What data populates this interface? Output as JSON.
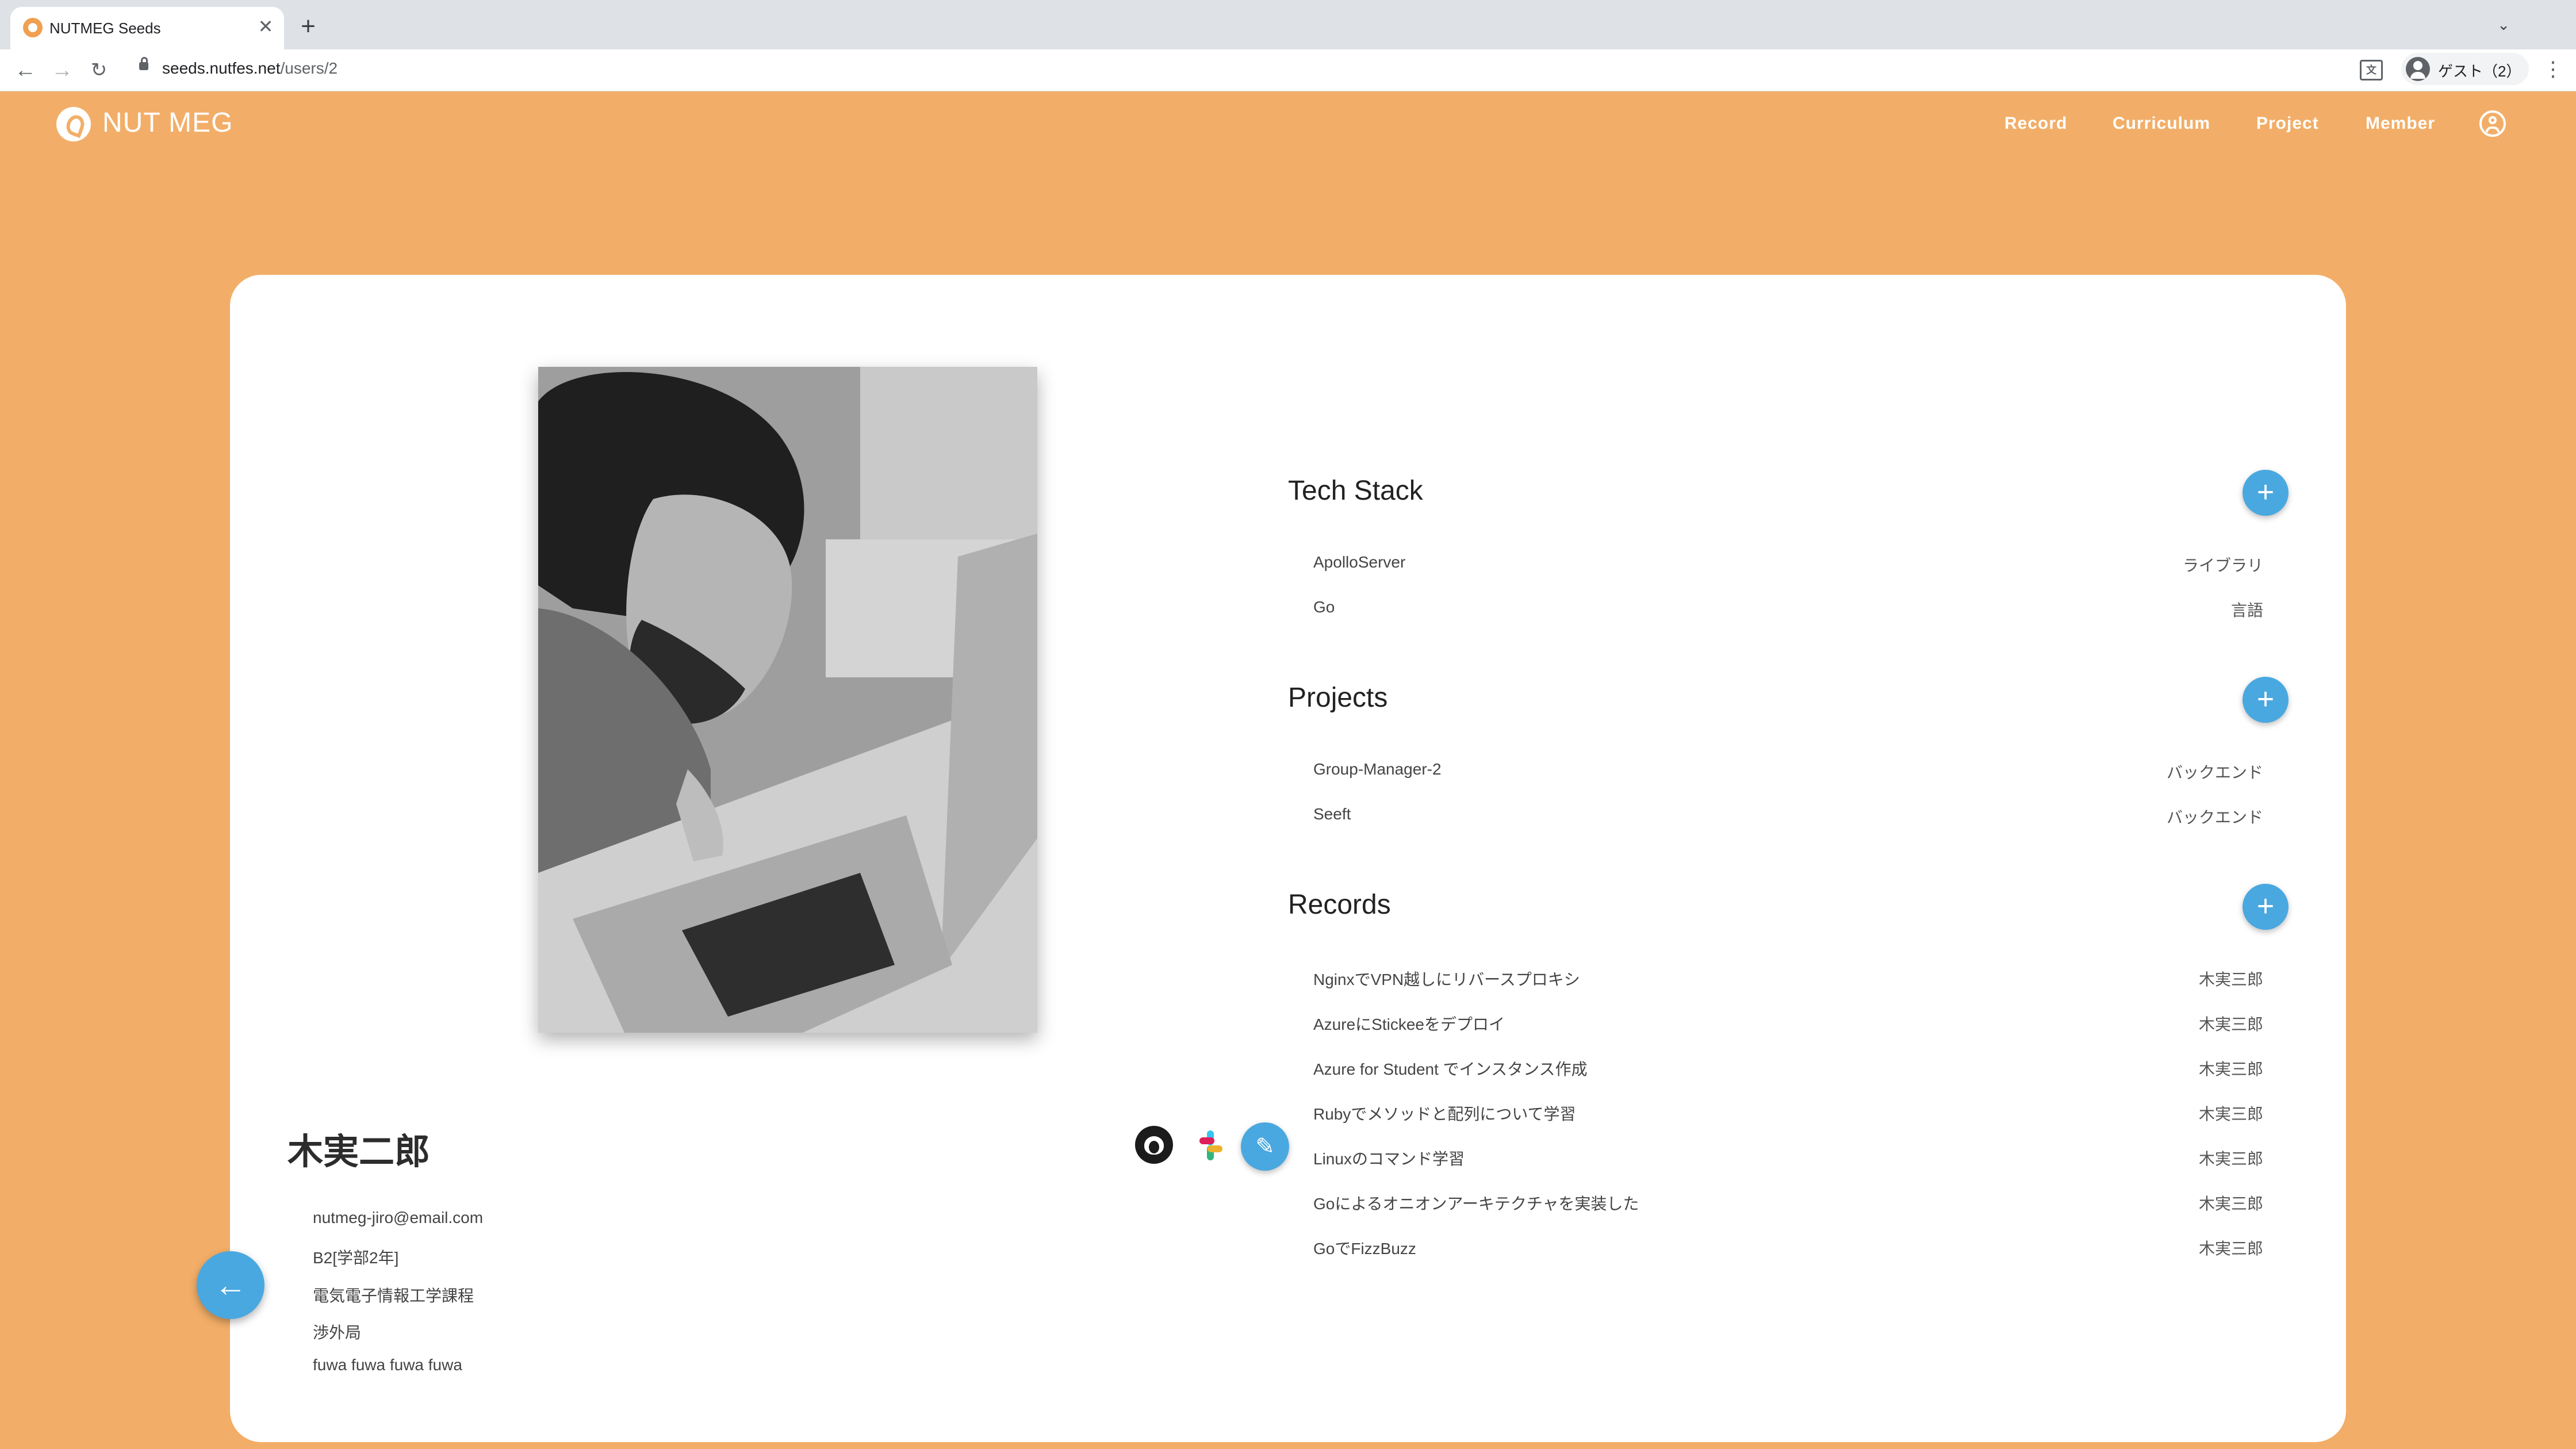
{
  "browser": {
    "tab_title": "NUTMEG Seeds",
    "tab_close": "✕",
    "new_tab": "+",
    "url_host": "seeds.nutfes.net",
    "url_path": "/users/2",
    "profile_label": "ゲスト（2）"
  },
  "navbar": {
    "logo_text": "NUT MEG",
    "links": [
      "Record",
      "Curriculum",
      "Project",
      "Member"
    ]
  },
  "user": {
    "name": "木実二郎",
    "email": "nutmeg-jiro@email.com",
    "grade": "B2[学部2年]",
    "course": "電気電子情報工学課程",
    "bureau": "渉外局",
    "bio": "fuwa fuwa fuwa fuwa"
  },
  "tech_stack": {
    "title": "Tech Stack",
    "items": [
      {
        "name": "ApolloServer",
        "category": "ライブラリ"
      },
      {
        "name": "Go",
        "category": "言語"
      }
    ]
  },
  "projects": {
    "title": "Projects",
    "items": [
      {
        "name": "Group-Manager-2",
        "role": "バックエンド"
      },
      {
        "name": "Seeft",
        "role": "バックエンド"
      }
    ]
  },
  "records": {
    "title": "Records",
    "items": [
      {
        "title": "NginxでVPN越しにリバースプロキシ",
        "author": "木実三郎"
      },
      {
        "title": "AzureにStickeeをデプロイ",
        "author": "木実三郎"
      },
      {
        "title": "Azure for Student でインスタンス作成",
        "author": "木実三郎"
      },
      {
        "title": "Rubyでメソッドと配列について学習",
        "author": "木実三郎"
      },
      {
        "title": "Linuxのコマンド学習",
        "author": "木実三郎"
      },
      {
        "title": "Goによるオニオンアーキテクチャを実装した",
        "author": "木実三郎"
      },
      {
        "title": "GoでFizzBuzz",
        "author": "木実三郎"
      }
    ]
  },
  "colors": {
    "page_bg": "#f2ae68",
    "accent_button": "#4aa8e0"
  }
}
